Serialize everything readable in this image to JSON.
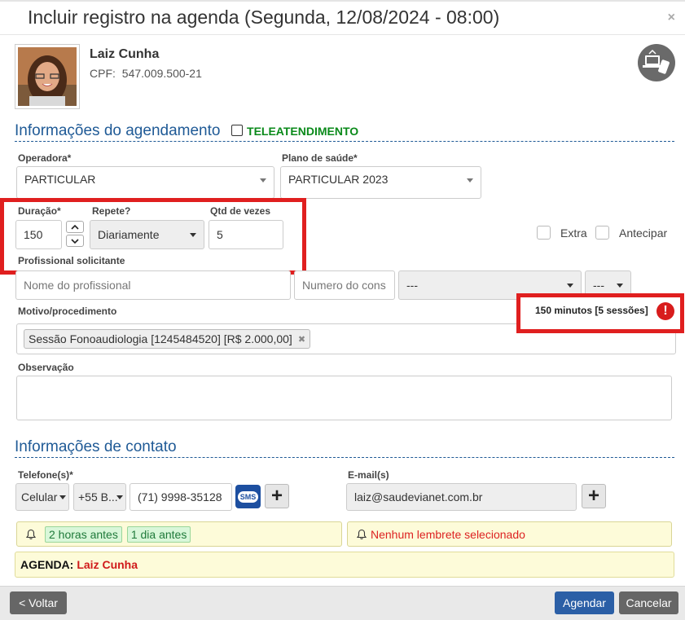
{
  "dialog": {
    "title": "Incluir registro na agenda (Segunda, 12/08/2024 - 08:00)",
    "close": "×"
  },
  "patient": {
    "name": "Laiz Cunha",
    "cpf_label": "CPF:",
    "cpf": "547.009.500-21"
  },
  "sec_agendamento": {
    "title": "Informações do agendamento",
    "teleatendimento": "TELEATENDIMENTO"
  },
  "operadora": {
    "label": "Operadora*",
    "value": "PARTICULAR"
  },
  "plano": {
    "label": "Plano de saúde*",
    "value": "PARTICULAR 2023"
  },
  "duracao": {
    "label": "Duração*",
    "value": "150"
  },
  "repete": {
    "label": "Repete?",
    "value": "Diariamente"
  },
  "qtd": {
    "label": "Qtd de vezes",
    "value": "5"
  },
  "extra": {
    "label": "Extra"
  },
  "antecipar": {
    "label": "Antecipar"
  },
  "solicitante": {
    "label": "Profissional solicitante",
    "nome_placeholder": "Nome do profissional",
    "numero_placeholder": "Numero do cons",
    "select1": "---",
    "select2": "---"
  },
  "motivo": {
    "label": "Motivo/procedimento",
    "summary": "150 minutos [5 sessões]",
    "warn": "!",
    "tag": "Sessão Fonoaudiologia [1245484520] [R$ 2.000,00]",
    "tag_remove": "✖"
  },
  "observacao": {
    "label": "Observação"
  },
  "sec_contato": {
    "title": "Informações de contato"
  },
  "telefone": {
    "label": "Telefone(s)*",
    "tipo": "Celular",
    "ddi": "+55 B...",
    "numero": "(71) 9998-35128",
    "sms": "SMS",
    "add": "+"
  },
  "email": {
    "label": "E-mail(s)",
    "value": "laiz@saudevianet.com.br",
    "add": "+"
  },
  "lembretes": {
    "options": [
      "2 horas antes",
      "1 dia antes"
    ],
    "email_none": "Nenhum lembrete selecionado"
  },
  "agenda": {
    "label": "AGENDA:",
    "name": "Laiz Cunha"
  },
  "footer": {
    "back": "< Voltar",
    "schedule": "Agendar",
    "cancel": "Cancelar"
  },
  "colors": {
    "accent": "#1f5a96",
    "red": "#e01f1f",
    "green": "#1f7a3a"
  }
}
